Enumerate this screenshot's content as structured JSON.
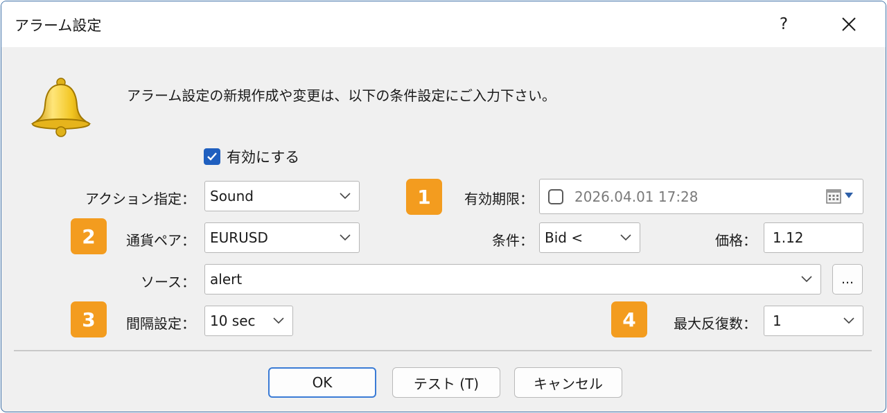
{
  "window": {
    "title": "アラーム設定",
    "help_label": "?"
  },
  "header": {
    "text": "アラーム設定の新規作成や変更は、以下の条件設定にご入力下さい。"
  },
  "enable": {
    "label": "有効にする",
    "checked": true
  },
  "action": {
    "label": "アクション指定：",
    "value": "Sound"
  },
  "expiry": {
    "badge": "1",
    "label": "有効期限：",
    "checked": false,
    "value": "2026.04.01 17:28"
  },
  "symbol": {
    "badge": "2",
    "label": "通貨ペア：",
    "value": "EURUSD"
  },
  "condition": {
    "label": "条件：",
    "value": "Bid <"
  },
  "price": {
    "label": "価格：",
    "value": "1.12"
  },
  "source": {
    "label": "ソース：",
    "value": "alert",
    "browse_label": "..."
  },
  "interval": {
    "badge": "3",
    "label": "間隔設定：",
    "value": "10 sec"
  },
  "max_iterations": {
    "badge": "4",
    "label": "最大反復数：",
    "value": "1"
  },
  "buttons": {
    "ok": "OK",
    "test": "テスト (T)",
    "cancel": "キャンセル"
  },
  "colors": {
    "accent": "#1f5fbf",
    "badge": "#f39c1f",
    "bell": "#f2c521"
  }
}
